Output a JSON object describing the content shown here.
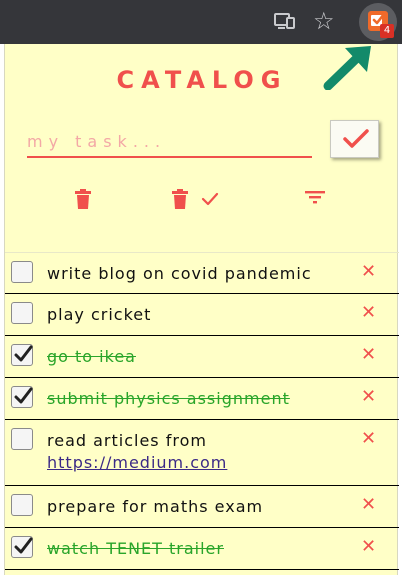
{
  "browser": {
    "extension_badge": "4"
  },
  "popup": {
    "title": "CATALOG",
    "input_placeholder": "my task...",
    "input_value": ""
  },
  "colors": {
    "accent": "#f0504c",
    "done_text": "#2aa52a",
    "background": "#ffffc7",
    "arrow": "#138a6a"
  },
  "icons": {
    "add": "check-icon",
    "delete_all": "trash-icon",
    "delete_done": "trash-check-icon",
    "filter": "filter-icon",
    "remove_task": "close-icon"
  },
  "tasks": [
    {
      "text": "write blog on covid pandemic",
      "done": false
    },
    {
      "text": "play cricket",
      "done": false
    },
    {
      "text": "go to ikea",
      "done": true
    },
    {
      "text": "submit physics assignment",
      "done": true
    },
    {
      "text": "read articles from",
      "link": "https://medium.com",
      "done": false
    },
    {
      "text": "prepare for maths exam",
      "done": false
    },
    {
      "text": "watch TENET trailer",
      "done": true
    }
  ]
}
